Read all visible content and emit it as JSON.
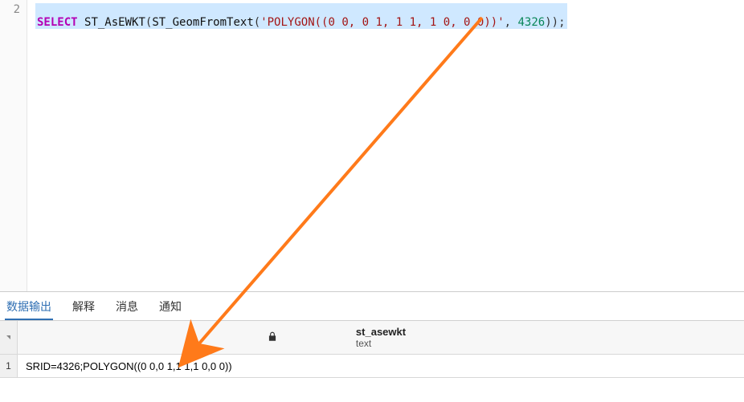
{
  "editor": {
    "line_number": "2",
    "tokens": {
      "kw": "SELECT",
      "sp1": " ",
      "func1": "ST_AsEWKT",
      "lp1": "(",
      "func2": "ST_GeomFromText",
      "lp2": "(",
      "str": "'POLYGON((0 0, 0 1, 1 1, 1 0, 0 0))'",
      "comma": ", ",
      "num": "4326",
      "rp2": ")",
      "rp1": ")",
      "semi": ";"
    }
  },
  "tabs": {
    "data_output": "数据输出",
    "explain": "解释",
    "messages": "消息",
    "notifications": "通知"
  },
  "results": {
    "header": {
      "col_name": "st_asewkt",
      "col_type": "text"
    },
    "rows": [
      {
        "idx": "1",
        "val": "SRID=4326;POLYGON((0 0,0 1,1 1,1 0,0 0))"
      }
    ]
  },
  "icons": {
    "lock": "lock"
  }
}
